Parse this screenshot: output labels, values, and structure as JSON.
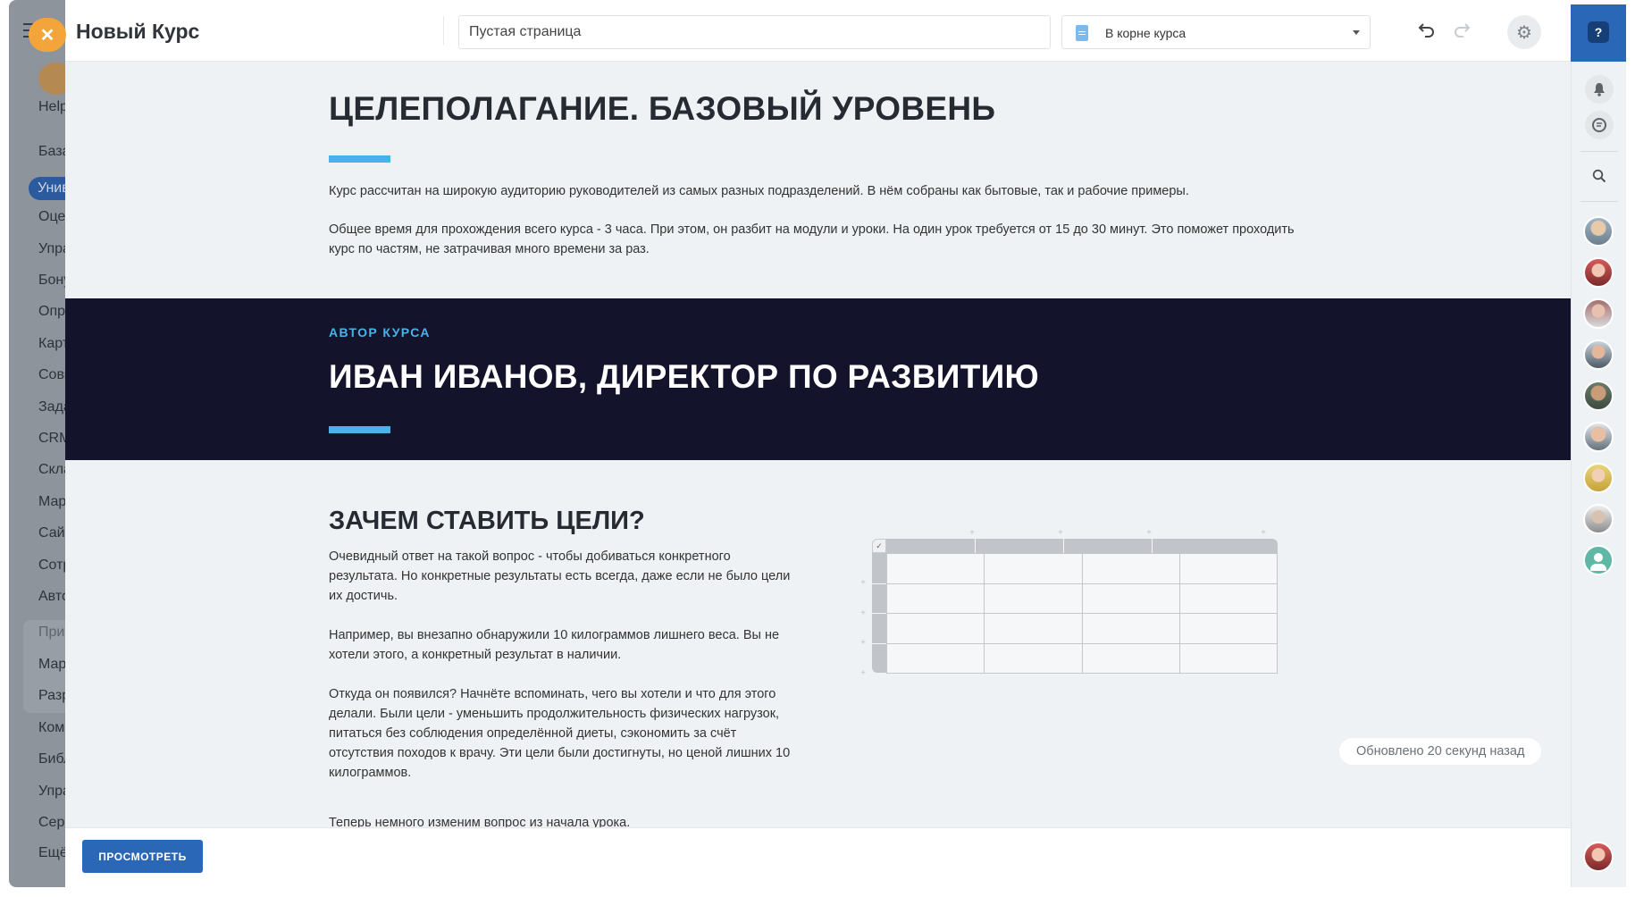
{
  "background_nav": {
    "items": [
      {
        "label": "Help"
      },
      {
        "label": "База"
      },
      {
        "label": "Унив"
      },
      {
        "label": "Оце"
      },
      {
        "label": "Упра"
      },
      {
        "label": "Бону"
      },
      {
        "label": "Опре"
      },
      {
        "label": "Карт"
      },
      {
        "label": "Совм"
      },
      {
        "label": "Зада"
      },
      {
        "label": "CRM"
      },
      {
        "label": "Скла"
      },
      {
        "label": "Мар"
      },
      {
        "label": "Сайт"
      },
      {
        "label": "Сотр"
      },
      {
        "label": "Авто"
      },
      {
        "label": "При"
      },
      {
        "label": "Мар"
      },
      {
        "label": "Разр"
      },
      {
        "label": "Ком"
      },
      {
        "label": "Библ"
      },
      {
        "label": "Упра"
      },
      {
        "label": "Серв"
      },
      {
        "label": "Ещё"
      }
    ],
    "active_label": "Унив"
  },
  "header": {
    "course_title": "Новый Курс",
    "page_name_value": "Пустая страница",
    "parent_select_value": "В корне курса"
  },
  "section_intro": {
    "title": "ЦЕЛЕПОЛАГАНИЕ. БАЗОВЫЙ УРОВЕНЬ",
    "para1": "Курс рассчитан на широкую аудиторию руководителей из самых разных подразделений. В нём собраны как бытовые, так и рабочие примеры.",
    "para2_line1": "Общее время для прохождения всего курса - 3 часа. При этом, он разбит на модули и уроки. На один урок требуется от 15 до 30 минут. Это поможет проходить",
    "para2_line2": "курс по частям, не затрачивая много времени за раз."
  },
  "section_author": {
    "kicker": "АВТОР КУРСА",
    "title": "ИВАН ИВАНОВ, ДИРЕКТОР ПО РАЗВИТИЮ"
  },
  "section_why": {
    "title": "ЗАЧЕМ СТАВИТЬ ЦЕЛИ?",
    "p1": "Очевидный ответ на такой вопрос - чтобы добиваться конкретного результата. Но конкретные результаты есть всегда, даже если не было цели их достичь.",
    "p2": "Например, вы внезапно обнаружили 10 килограммов лишнего веса. Вы не хотели этого, а конкретный результат в наличии.",
    "p3": "Откуда он появился? Начнёте вспоминать, чего вы хотели и что для этого делали. Были цели - уменьшить продолжительность физических нагрузок, питаться без соблюдения определённой диеты, сэкономить за счёт отсутствия походов к врачу. Эти цели были достигнуты, но ценой лишних 10 килограммов.",
    "p4": "Теперь немного изменим вопрос из начала урока."
  },
  "status": {
    "updated": "Обновлено 20 секунд назад"
  },
  "footer": {
    "preview_label": "ПРОСМОТРЕТЬ"
  },
  "icons": {
    "close": "close-icon",
    "undo": "undo-icon",
    "redo": "redo-icon",
    "settings": "gear-icon",
    "help": "help-icon",
    "bell": "bell-icon",
    "chat": "chat-icon",
    "search": "search-icon"
  },
  "colors": {
    "accent_blue": "#4ab2e8",
    "primary_button": "#2a67b7",
    "dark_section": "#13132b",
    "close_orange": "#f3a43b"
  }
}
